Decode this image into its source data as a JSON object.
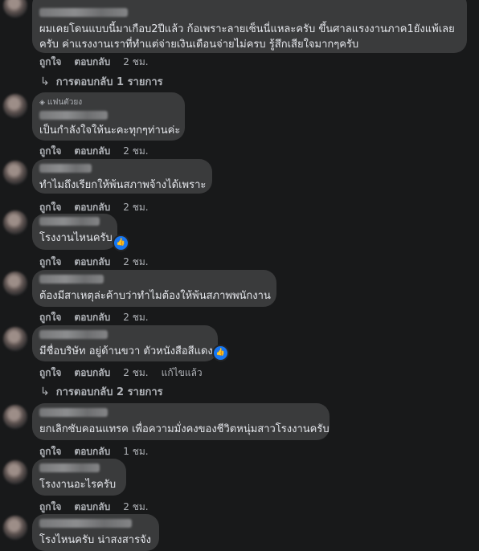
{
  "comments": [
    {
      "text_lines": [
        "ผมเคยโดนแบบนี้มาเกือบ2ปีแล้ว ก้อเพราะลายเซ็นนี่แหละครับ ขึ้นศาลแรงงานภาค1ยังแพ้เลย",
        "ครับ ค่าแรงงานเราที่ทำแต่จ่ายเงินเดือนจ่ายไม่ครบ รู้สึกเสียใจมากๆครับ"
      ],
      "like": "ถูกใจ",
      "reply": "ตอบกลับ",
      "time": "2 ชม.",
      "replies_label": "การตอบกลับ 1 รายการ"
    },
    {
      "badge": "แฟนตัวยง",
      "text_lines": [
        "เป็นกำลังใจให้นะคะทุกๆท่านค่ะ"
      ],
      "like": "ถูกใจ",
      "reply": "ตอบกลับ",
      "time": "2 ชม."
    },
    {
      "text_lines": [
        "ทำไมถึงเรียกให้พ้นสภาพจ้างได้เพราะ"
      ],
      "like": "ถูกใจ",
      "reply": "ตอบกลับ",
      "time": "2 ชม."
    },
    {
      "text_lines": [
        "โรงงานไหนครับ"
      ],
      "like": "ถูกใจ",
      "reply": "ตอบกลับ",
      "time": "2 ชม."
    },
    {
      "text_lines": [
        "ต้องมีสาเหตุล่ะค้าบว่าทำไมต้องให้พ้นสภาพพนักงาน"
      ],
      "like": "ถูกใจ",
      "reply": "ตอบกลับ",
      "time": "2 ชม."
    },
    {
      "text_lines": [
        "มีชื่อบริษัท อยู่ด้านขวา ตัวหนังสือสีแดง"
      ],
      "like": "ถูกใจ",
      "reply": "ตอบกลับ",
      "time": "2 ชม.",
      "edited": "แก้ไขแล้ว",
      "replies_label": "การตอบกลับ 2 รายการ"
    },
    {
      "text_lines": [
        "ยกเลิกซับคอนแทรค เพื่อความมั่งคงของชีวิตหนุ่มสาวโรงงานครับ"
      ],
      "like": "ถูกใจ",
      "reply": "ตอบกลับ",
      "time": "1 ชม."
    },
    {
      "text_lines": [
        "โรงงานอะไรครับ"
      ],
      "like": "ถูกใจ",
      "reply": "ตอบกลับ",
      "time": "2 ชม."
    },
    {
      "text_lines": [
        "โรงไหนครับ น่าสงสารจัง"
      ]
    }
  ],
  "colors": {
    "background": "#18191a",
    "bubble": "#3a3b3c",
    "text": "#e4e6eb",
    "muted": "#b0b3b8",
    "like_blue": "#1877f2"
  },
  "icons": {
    "like_reaction": "thumbs-up-icon",
    "reply_arrow": "reply-arrow-icon",
    "fan_badge": "diamond-icon"
  }
}
